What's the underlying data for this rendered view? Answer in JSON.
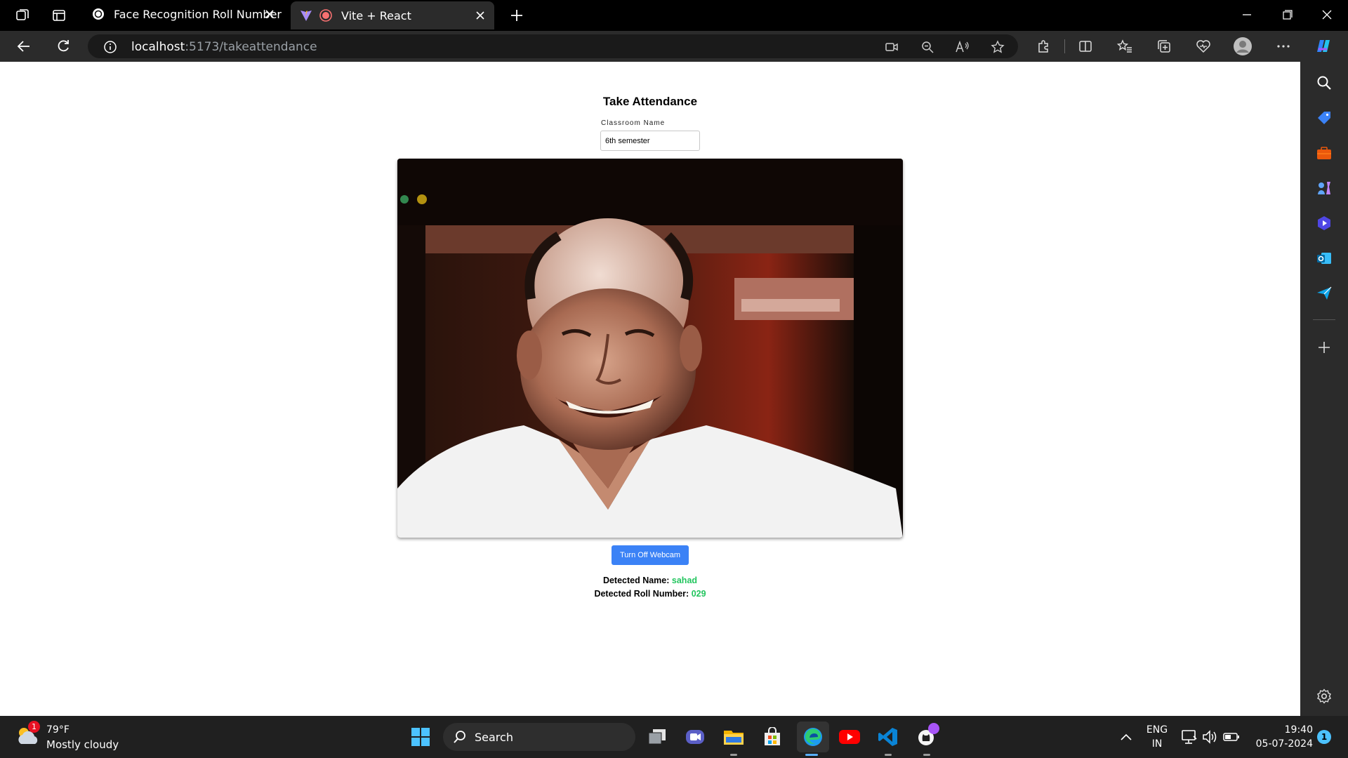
{
  "browser": {
    "tabs": [
      {
        "title": "Face Recognition Roll Number",
        "active": false
      },
      {
        "title": "Vite + React",
        "active": true
      }
    ],
    "url_host": "localhost",
    "url_path": ":5173/takeattendance"
  },
  "page": {
    "title": "Take Attendance",
    "classroom_label": "Classroom Name",
    "classroom_value": "6th semester",
    "webcam_button": "Turn Off Webcam",
    "detected_name_label": "Detected Name:",
    "detected_name_value": "sahad",
    "detected_roll_label": "Detected Roll Number:",
    "detected_roll_value": "029",
    "accent_color": "#3b82f6",
    "success_color": "#22c55e"
  },
  "taskbar": {
    "weather_temp": "79°F",
    "weather_desc": "Mostly cloudy",
    "weather_badge": "1",
    "search_label": "Search",
    "lang_top": "ENG",
    "lang_bottom": "IN",
    "time": "19:40",
    "date": "05-07-2024",
    "notification_count": "1"
  }
}
